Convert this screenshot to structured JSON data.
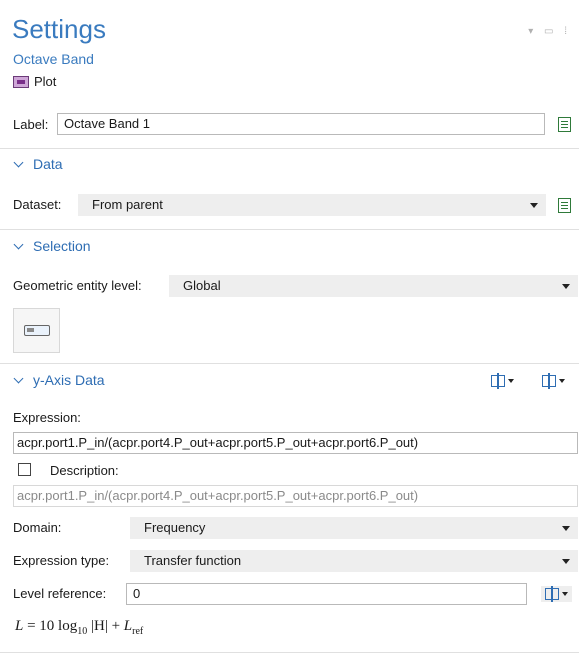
{
  "header": {
    "title": "Settings",
    "subtitle": "Octave Band",
    "node_type": "Plot"
  },
  "label_row": {
    "label": "Label:",
    "value": "Octave Band 1"
  },
  "sections": {
    "data": "Data",
    "selection": "Selection",
    "y_axis": "y-Axis Data"
  },
  "data": {
    "dataset_label": "Dataset:",
    "dataset_value": "From parent"
  },
  "selection": {
    "level_label": "Geometric entity level:",
    "level_value": "Global"
  },
  "y_axis": {
    "expression_label": "Expression:",
    "expression_value": "acpr.port1.P_in/(acpr.port4.P_out+acpr.port5.P_out+acpr.port6.P_out)",
    "description_label": "Description:",
    "description_value": "acpr.port1.P_in/(acpr.port4.P_out+acpr.port5.P_out+acpr.port6.P_out)",
    "domain_label": "Domain:",
    "domain_value": "Frequency",
    "expr_type_label": "Expression type:",
    "expr_type_value": "Transfer function",
    "level_ref_label": "Level reference:",
    "level_ref_value": "0",
    "formula": {
      "lhs": "L",
      "eq": " = 10 log",
      "log_sub": "10",
      "abs": " |H| + ",
      "L": "L",
      "ref": "ref"
    }
  },
  "icons": {
    "plot": "plot-node-icon",
    "label_action": "document-icon",
    "dataset_action": "dataset-link-icon",
    "column_tools": "column-insert-icon",
    "entity": "global-entity-icon"
  },
  "colors": {
    "accent": "#3a7bbf",
    "section": "#2e6db3",
    "select_bg": "#eeeeee"
  }
}
